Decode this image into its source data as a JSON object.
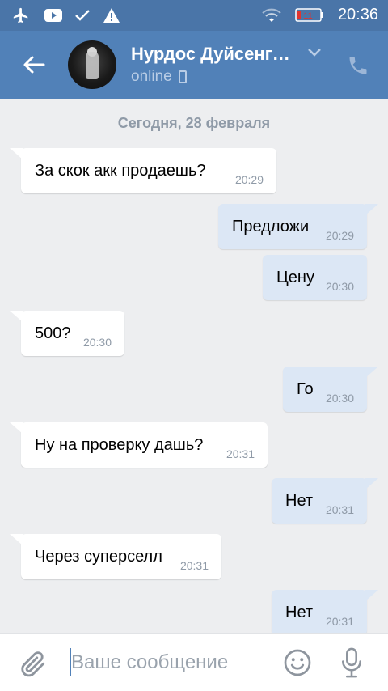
{
  "status_bar": {
    "icons": [
      "airplane-icon",
      "youtube-icon",
      "check-icon",
      "warning-icon",
      "wifi-icon",
      "battery-icon"
    ],
    "battery_level": "11",
    "time": "20:36"
  },
  "header": {
    "contact_name": "Нурдос Дуйсенг…",
    "presence": "online"
  },
  "chat": {
    "date_separator": "Сегодня, 28 февраля",
    "messages": [
      {
        "dir": "in",
        "text": "За скок акк продаешь?",
        "time": "20:29"
      },
      {
        "dir": "out",
        "text": "Предложи",
        "time": "20:29"
      },
      {
        "dir": "out",
        "text": "Цену",
        "time": "20:30"
      },
      {
        "dir": "in",
        "text": "500?",
        "time": "20:30"
      },
      {
        "dir": "out",
        "text": "Го",
        "time": "20:30"
      },
      {
        "dir": "in",
        "text": "Ну на проверку дашь?",
        "time": "20:31"
      },
      {
        "dir": "out",
        "text": "Нет",
        "time": "20:31"
      },
      {
        "dir": "in",
        "text": "Через суперселл",
        "time": "20:31"
      },
      {
        "dir": "out",
        "text": "Нет",
        "time": "20:31"
      }
    ]
  },
  "composer": {
    "placeholder": "Ваше сообщение"
  },
  "colors": {
    "header": "#5181b8",
    "status_bar": "#4a75a8",
    "chat_bg": "#edeef0",
    "incoming_bubble": "#ffffff",
    "outgoing_bubble": "#dce7f5"
  }
}
